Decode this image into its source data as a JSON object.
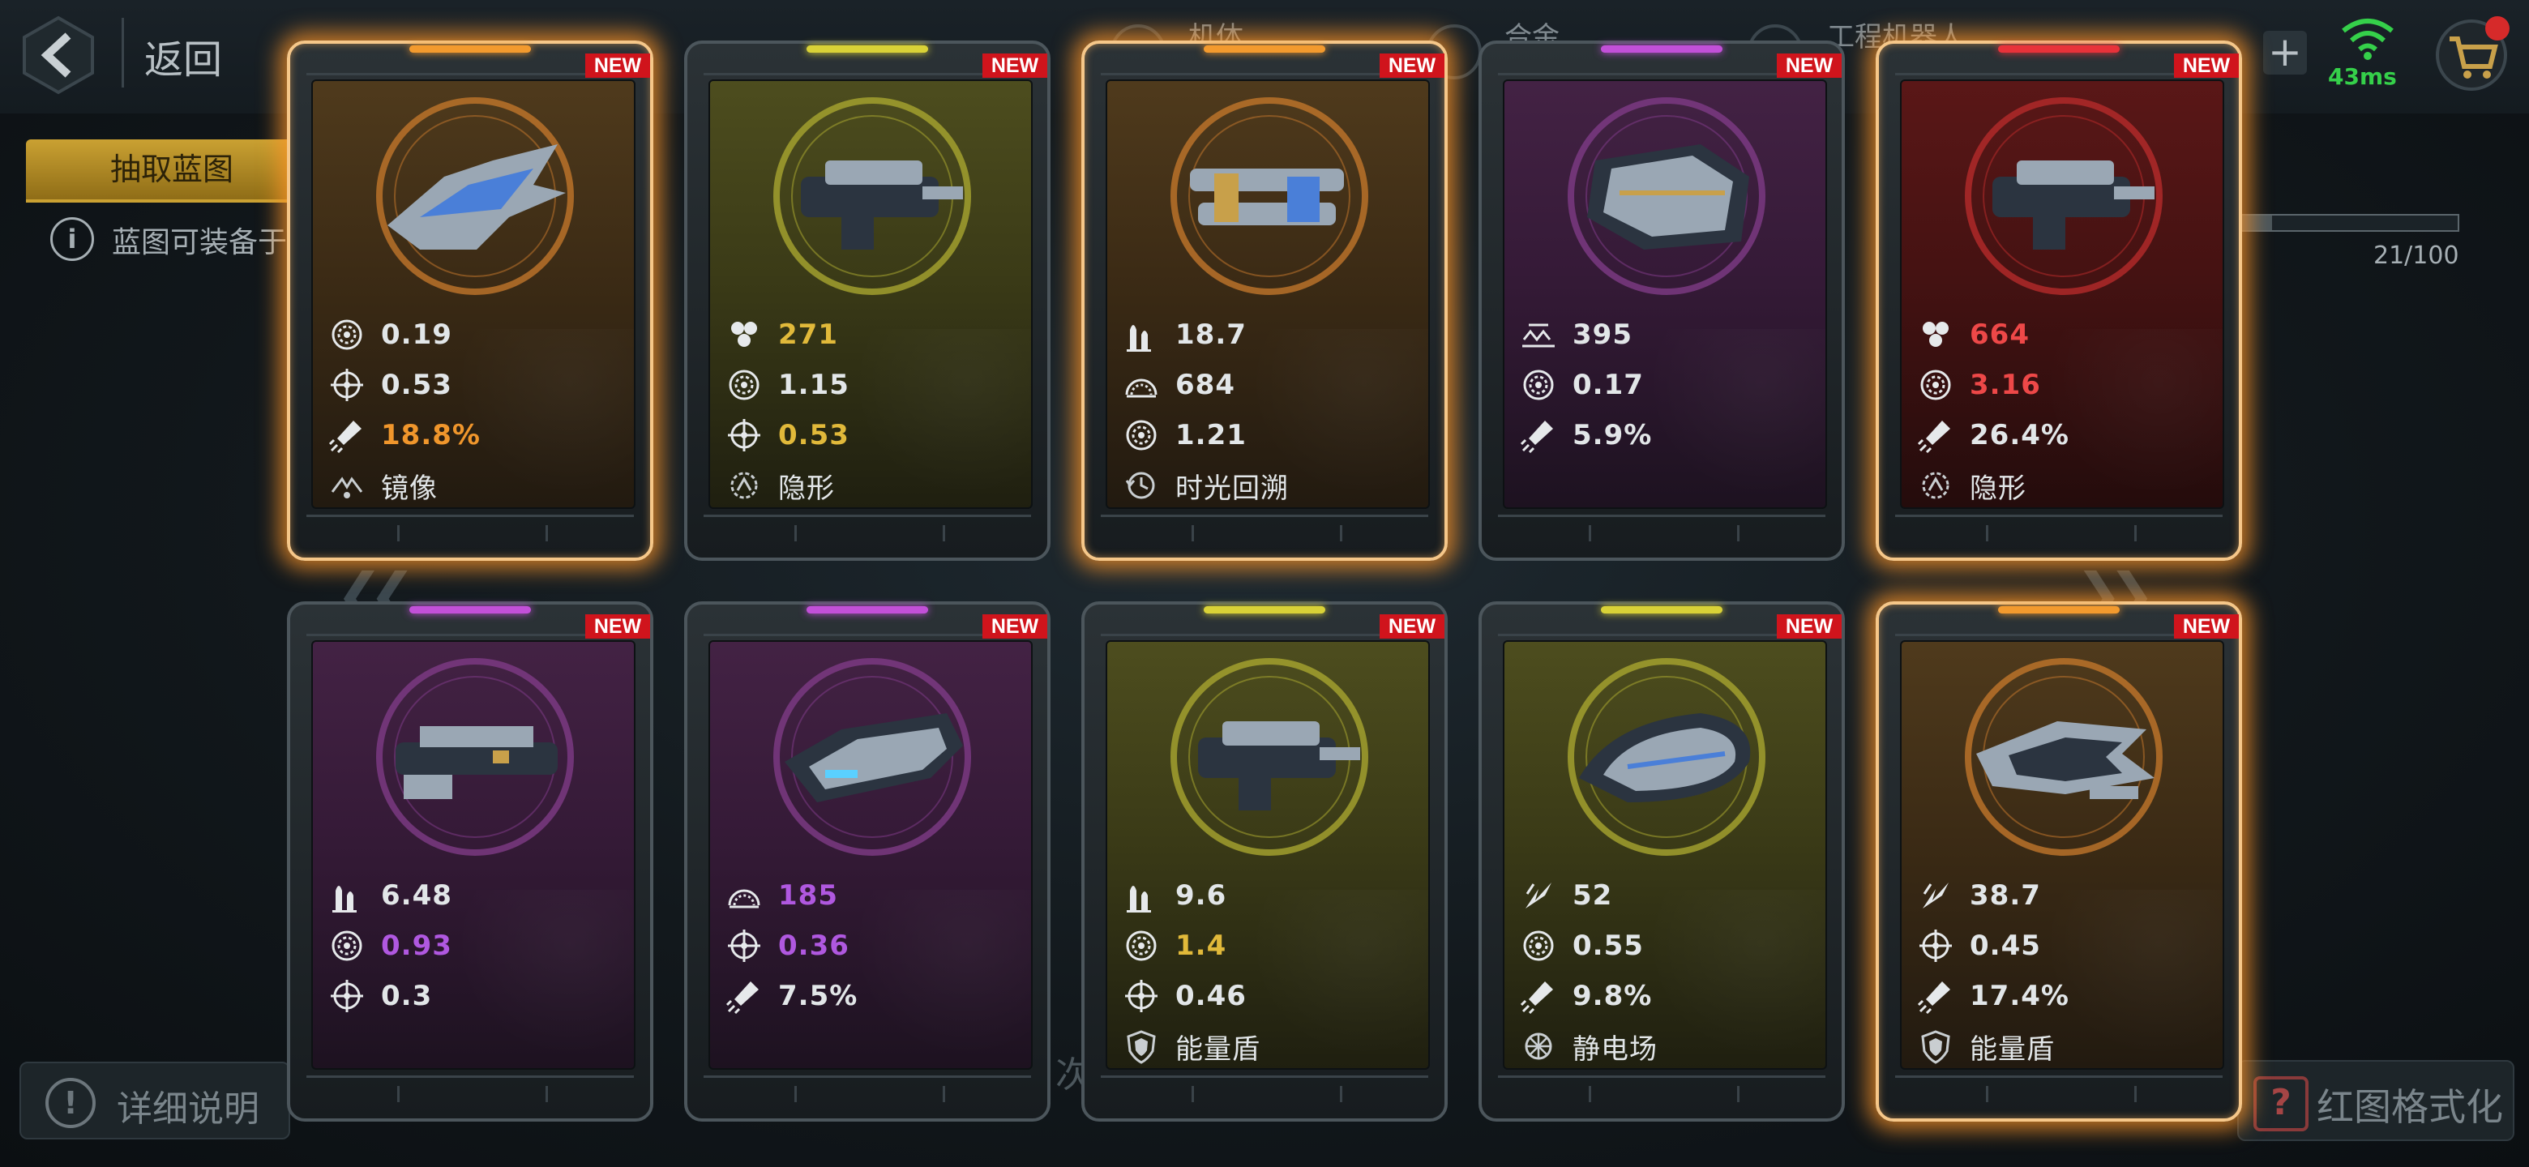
{
  "header": {
    "back_label": "返回",
    "tabs": [
      "机体",
      "合金",
      "工程机器人"
    ],
    "ping": "43ms"
  },
  "sidebar": {
    "extract_tab": "抽取蓝图",
    "info_text": "蓝图可装备于"
  },
  "progress": {
    "text": "21/100",
    "fraction": 0.21
  },
  "footer": {
    "detail_label": "详细说明",
    "format_label": "红图格式化",
    "center_text": "次"
  },
  "colors": {
    "orange": "#f0962c",
    "yellow": "#e1b93a",
    "purple": "#b058e0",
    "red": "#ee4848",
    "new_tag": "#d0141c"
  },
  "cards": [
    {
      "rarity": "orange",
      "glow": true,
      "new_label": "NEW",
      "stats": [
        {
          "icon": "reload-icon",
          "value": "0.19",
          "color": ""
        },
        {
          "icon": "accuracy-icon",
          "value": "0.53",
          "color": ""
        },
        {
          "icon": "missile-icon",
          "value": "18.8%",
          "color": "orange"
        },
        {
          "icon": "mirror-skill-icon",
          "value": "镜像",
          "color": "",
          "skill": true
        }
      ]
    },
    {
      "rarity": "yellow",
      "glow": false,
      "new_label": "NEW",
      "stats": [
        {
          "icon": "cluster-icon",
          "value": "271",
          "color": "yellow"
        },
        {
          "icon": "reload-icon",
          "value": "1.15",
          "color": ""
        },
        {
          "icon": "accuracy-icon",
          "value": "0.53",
          "color": "yellow"
        },
        {
          "icon": "stealth-skill-icon",
          "value": "隐形",
          "color": "",
          "skill": true
        }
      ]
    },
    {
      "rarity": "orange",
      "glow": true,
      "new_label": "NEW",
      "stats": [
        {
          "icon": "ammo-icon",
          "value": "18.7",
          "color": ""
        },
        {
          "icon": "range-icon",
          "value": "684",
          "color": ""
        },
        {
          "icon": "reload-icon",
          "value": "1.21",
          "color": ""
        },
        {
          "icon": "time-rewind-skill-icon",
          "value": "时光回溯",
          "color": "",
          "skill": true
        }
      ]
    },
    {
      "rarity": "purple",
      "glow": false,
      "new_label": "NEW",
      "stats": [
        {
          "icon": "spread-icon",
          "value": "395",
          "color": ""
        },
        {
          "icon": "reload-icon",
          "value": "0.17",
          "color": ""
        },
        {
          "icon": "missile-icon",
          "value": "5.9%",
          "color": ""
        }
      ]
    },
    {
      "rarity": "red",
      "glow": true,
      "new_label": "NEW",
      "stats": [
        {
          "icon": "cluster-icon",
          "value": "664",
          "color": "red"
        },
        {
          "icon": "reload-icon",
          "value": "3.16",
          "color": "red"
        },
        {
          "icon": "missile-icon",
          "value": "26.4%",
          "color": ""
        },
        {
          "icon": "stealth-skill-icon",
          "value": "隐形",
          "color": "",
          "skill": true
        }
      ]
    },
    {
      "rarity": "purple",
      "glow": false,
      "new_label": "NEW",
      "stats": [
        {
          "icon": "ammo-icon",
          "value": "6.48",
          "color": ""
        },
        {
          "icon": "reload-icon",
          "value": "0.93",
          "color": "purple"
        },
        {
          "icon": "accuracy-icon",
          "value": "0.3",
          "color": ""
        }
      ]
    },
    {
      "rarity": "purple",
      "glow": false,
      "new_label": "NEW",
      "stats": [
        {
          "icon": "range-icon",
          "value": "185",
          "color": "purple"
        },
        {
          "icon": "accuracy-icon",
          "value": "0.36",
          "color": "purple"
        },
        {
          "icon": "missile-icon",
          "value": "7.5%",
          "color": ""
        }
      ]
    },
    {
      "rarity": "yellow",
      "glow": false,
      "new_label": "NEW",
      "stats": [
        {
          "icon": "ammo-icon",
          "value": "9.6",
          "color": ""
        },
        {
          "icon": "reload-icon",
          "value": "1.4",
          "color": "yellow"
        },
        {
          "icon": "accuracy-icon",
          "value": "0.46",
          "color": ""
        },
        {
          "icon": "energy-shield-skill-icon",
          "value": "能量盾",
          "color": "",
          "skill": true
        }
      ]
    },
    {
      "rarity": "yellow",
      "glow": false,
      "new_label": "NEW",
      "stats": [
        {
          "icon": "damage-icon",
          "value": "52",
          "color": ""
        },
        {
          "icon": "reload-icon",
          "value": "0.55",
          "color": ""
        },
        {
          "icon": "missile-icon",
          "value": "9.8%",
          "color": ""
        },
        {
          "icon": "static-field-skill-icon",
          "value": "静电场",
          "color": "",
          "skill": true
        }
      ]
    },
    {
      "rarity": "orange",
      "glow": true,
      "new_label": "NEW",
      "stats": [
        {
          "icon": "damage-icon",
          "value": "38.7",
          "color": ""
        },
        {
          "icon": "accuracy-icon",
          "value": "0.45",
          "color": ""
        },
        {
          "icon": "missile-icon",
          "value": "17.4%",
          "color": ""
        },
        {
          "icon": "energy-shield-skill-icon",
          "value": "能量盾",
          "color": "",
          "skill": true
        }
      ]
    }
  ]
}
